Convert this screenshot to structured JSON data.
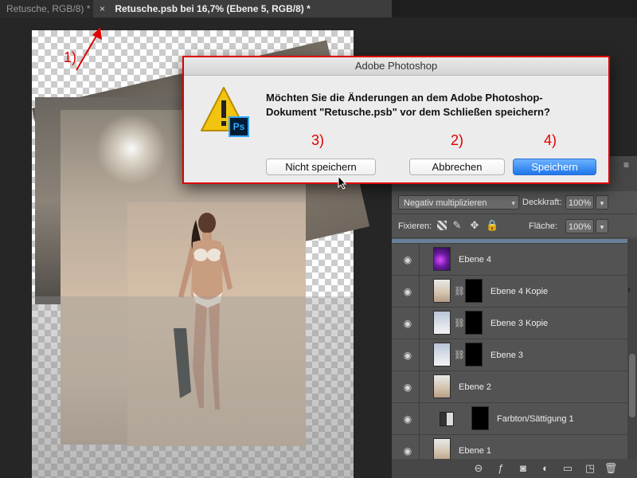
{
  "tabs": {
    "inactive_label": "Retusche, RGB/8) *",
    "active_label": "Retusche.psb bei 16,7% (Ebene 5, RGB/8) *",
    "close_glyph": "×"
  },
  "annotations": {
    "step1": "1)",
    "step2": "2)",
    "step3": "3)",
    "step4": "4)",
    "color": "#e00000"
  },
  "dialog": {
    "title": "Adobe Photoshop",
    "message_line1": "Möchten Sie die Änderungen an dem Adobe Photoshop-",
    "message_line2": "Dokument \"Retusche.psb\" vor dem Schließen speichern?",
    "icon": "warning-photoshop-icon",
    "ps_badge": "Ps",
    "buttons": {
      "dont_save": "Nicht speichern",
      "cancel": "Abbrechen",
      "save": "Speichern"
    }
  },
  "layers_panel": {
    "blend_mode": "Negativ multiplizieren",
    "opacity_label": "Deckkraft:",
    "opacity_value": "100%",
    "lock_label": "Fixieren:",
    "fill_label": "Fläche:",
    "fill_value": "100%",
    "dropdown_glyph": "▾",
    "layers": [
      {
        "name": "Ebene 4",
        "visible": true,
        "thumb": "purple",
        "mask": false
      },
      {
        "name": "Ebene 4 Kopie",
        "visible": true,
        "thumb": "photo",
        "mask": true
      },
      {
        "name": "Ebene 3 Kopie",
        "visible": true,
        "thumb": "sky",
        "mask": true
      },
      {
        "name": "Ebene 3",
        "visible": true,
        "thumb": "sky",
        "mask": true
      },
      {
        "name": "Ebene 2",
        "visible": true,
        "thumb": "photo",
        "mask": false
      },
      {
        "name": "Farbton/Sättigung 1",
        "visible": true,
        "thumb": "adjustment",
        "mask": true
      },
      {
        "name": "Ebene 1",
        "visible": true,
        "thumb": "photo",
        "mask": false
      }
    ],
    "footer_icons": [
      "link-icon",
      "fx-icon",
      "mask-icon",
      "adjustment-icon",
      "folder-icon",
      "new-layer-icon",
      "trash-icon"
    ]
  }
}
